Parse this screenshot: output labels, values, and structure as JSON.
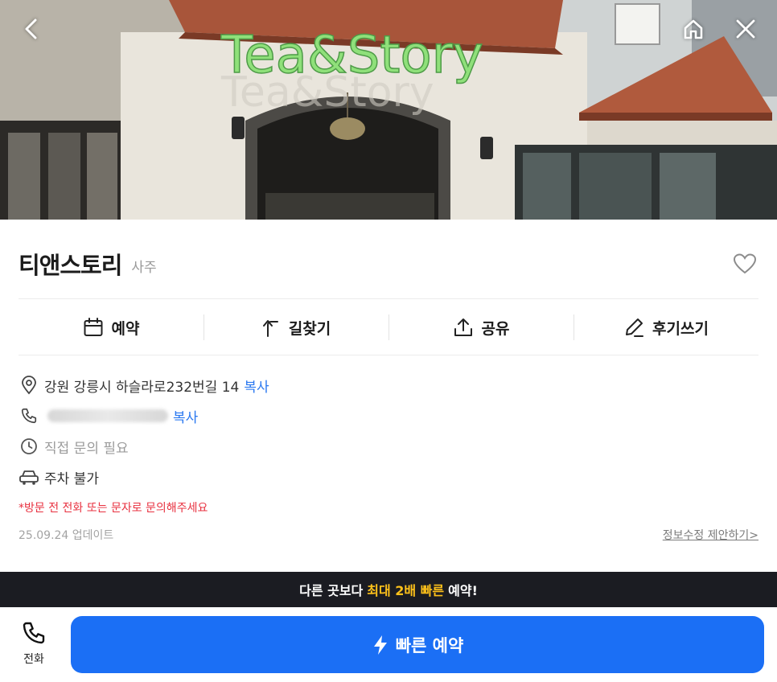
{
  "hero": {
    "sign_text": "Tea&Story",
    "nav": {
      "back": "chevron-left-icon",
      "home": "home-icon",
      "close": "close-icon"
    }
  },
  "shop": {
    "name": "티앤스토리",
    "category": "사주",
    "favorite_icon": "heart-outline-icon"
  },
  "actions": [
    {
      "label": "예약",
      "icon": "calendar-icon"
    },
    {
      "label": "길찾기",
      "icon": "turn-arrow-icon"
    },
    {
      "label": "공유",
      "icon": "share-icon"
    },
    {
      "label": "후기쓰기",
      "icon": "pencil-icon"
    }
  ],
  "info": {
    "address": "강원 강릉시 하슬라로232번길 14",
    "address_copy": "복사",
    "phone_copy": "복사",
    "hours": "직접 문의 필요",
    "parking": "주차 불가",
    "notice": "*방문 전 전화 또는 문자로 문의해주세요",
    "updated": "25.09.24 업데이트",
    "suggest": "정보수정 제안하기>"
  },
  "banner": {
    "prefix": "다른 곳보다",
    "highlight": "최대 2배 빠른",
    "suffix": "예약!"
  },
  "bottom": {
    "call_label": "전화",
    "book_label": "빠른 예약"
  },
  "colors": {
    "accent": "#1b6ff5",
    "link": "#2a78f0",
    "notice": "#e8303f",
    "banner_bg": "#1b1c22",
    "banner_highlight": "#ffc21a"
  }
}
